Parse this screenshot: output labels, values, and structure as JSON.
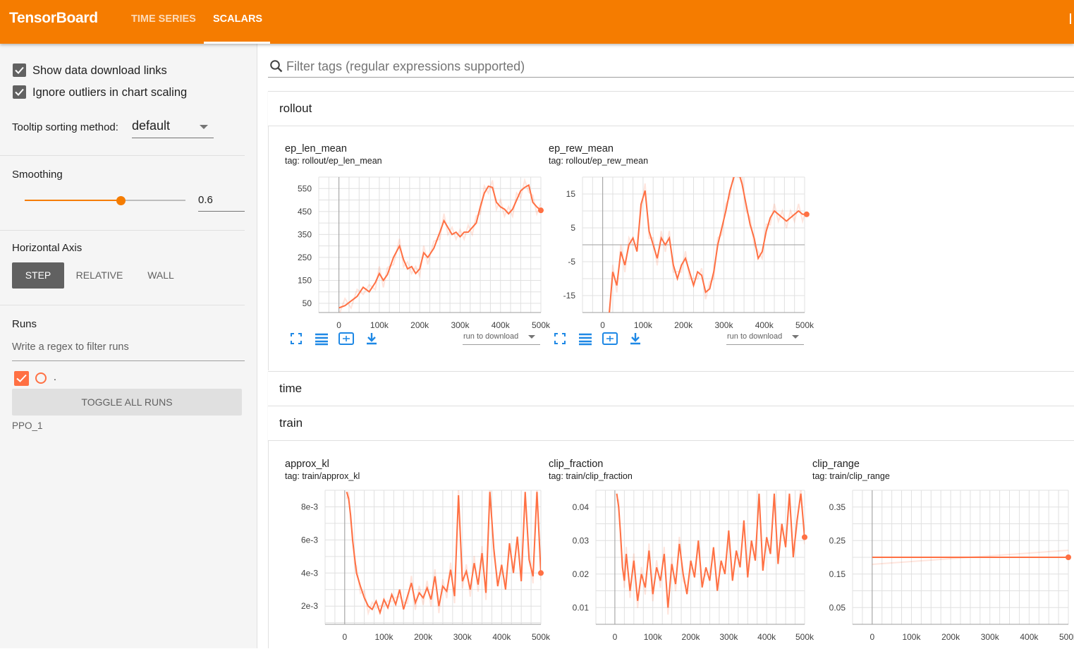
{
  "header": {
    "brand": "TensorBoard",
    "tabs": [
      {
        "label": "TIME SERIES",
        "active": false
      },
      {
        "label": "SCALARS",
        "active": true
      }
    ],
    "color": "#f57c00"
  },
  "sidebar": {
    "show_download_links": {
      "label": "Show data download links",
      "checked": true
    },
    "ignore_outliers": {
      "label": "Ignore outliers in chart scaling",
      "checked": true
    },
    "tooltip_sorting": {
      "label": "Tooltip sorting method:",
      "value": "default"
    },
    "smoothing": {
      "label": "Smoothing",
      "value": "0.6",
      "fraction": 0.6
    },
    "horizontal_axis": {
      "label": "Horizontal Axis",
      "options": [
        "STEP",
        "RELATIVE",
        "WALL"
      ],
      "selected": "STEP"
    },
    "runs": {
      "label": "Runs",
      "filter_placeholder": "Write a regex to filter runs",
      "items": [
        {
          "name": ".",
          "checked": true,
          "color": "#ff7043"
        }
      ],
      "toggle_label": "TOGGLE ALL RUNS",
      "group": "PPO_1"
    }
  },
  "main": {
    "search_placeholder": "Filter tags (regular expressions supported)",
    "download_select": "run to download",
    "sections": [
      {
        "title": "rollout"
      },
      {
        "title": "time"
      },
      {
        "title": "train"
      }
    ]
  },
  "chart_data": [
    {
      "type": "line",
      "title": "ep_len_mean",
      "tag": "tag: rollout/ep_len_mean",
      "xlim": [
        -50,
        500
      ],
      "ylim": [
        10,
        600
      ],
      "xticks": [
        0,
        100,
        200,
        300,
        400,
        500
      ],
      "xtick_labels": [
        "0",
        "100k",
        "200k",
        "300k",
        "400k",
        "500k"
      ],
      "yticks": [
        50,
        150,
        250,
        350,
        450,
        550
      ],
      "ytick_labels": [
        "50",
        "150",
        "250",
        "350",
        "450",
        "550"
      ],
      "color": "#ff7043",
      "series": [
        {
          "x": [
            0,
            15,
            30,
            45,
            60,
            75,
            90,
            100,
            110,
            120,
            135,
            150,
            160,
            170,
            180,
            190,
            200,
            210,
            220,
            235,
            250,
            260,
            270,
            280,
            290,
            300,
            310,
            320,
            330,
            340,
            350,
            360,
            370,
            380,
            390,
            400,
            410,
            420,
            430,
            440,
            450,
            460,
            470,
            480,
            490,
            500
          ],
          "values": [
            30,
            40,
            60,
            80,
            120,
            100,
            140,
            180,
            150,
            175,
            250,
            300,
            240,
            200,
            210,
            180,
            200,
            270,
            250,
            290,
            360,
            410,
            380,
            350,
            360,
            340,
            360,
            360,
            380,
            400,
            470,
            530,
            560,
            555,
            490,
            470,
            460,
            440,
            460,
            500,
            540,
            555,
            565,
            490,
            470,
            455
          ]
        }
      ]
    },
    {
      "type": "line",
      "title": "ep_rew_mean",
      "tag": "tag: rollout/ep_rew_mean",
      "xlim": [
        -50,
        500
      ],
      "ylim": [
        -20,
        20
      ],
      "xticks": [
        0,
        100,
        200,
        300,
        400,
        500
      ],
      "xtick_labels": [
        "0",
        "100k",
        "200k",
        "300k",
        "400k",
        "500k"
      ],
      "yticks": [
        -15,
        -5,
        5,
        15
      ],
      "ytick_labels": [
        "-15",
        "-5",
        "5",
        "15"
      ],
      "color": "#ff7043",
      "series": [
        {
          "x": [
            15,
            25,
            35,
            45,
            55,
            65,
            75,
            85,
            95,
            105,
            115,
            125,
            135,
            145,
            155,
            165,
            175,
            185,
            195,
            205,
            215,
            225,
            235,
            245,
            255,
            265,
            275,
            285,
            295,
            305,
            315,
            325,
            335,
            345,
            355,
            365,
            375,
            385,
            395,
            405,
            415,
            425,
            435,
            445,
            455,
            465,
            475,
            485,
            495,
            505
          ],
          "values": [
            -22,
            -8,
            -12,
            -2,
            -6,
            0,
            2,
            -2,
            12,
            16,
            4,
            0,
            -4,
            2,
            0,
            2,
            -6,
            -10,
            -6,
            -4,
            -8,
            -12,
            -8,
            -9,
            -14,
            -13,
            -8,
            0,
            5,
            10,
            16,
            20,
            22,
            18,
            12,
            6,
            2,
            -4,
            -2,
            4,
            8,
            10,
            9,
            8,
            7,
            8,
            9,
            10,
            9,
            9
          ]
        }
      ]
    },
    {
      "type": "line",
      "title": "approx_kl",
      "tag": "tag: train/approx_kl",
      "xlim": [
        -50,
        500
      ],
      "ylim": [
        0.0009,
        0.009
      ],
      "xticks": [
        0,
        100,
        200,
        300,
        400,
        500
      ],
      "xtick_labels": [
        "0",
        "100k",
        "200k",
        "300k",
        "400k",
        "500k"
      ],
      "yticks": [
        0.002,
        0.004,
        0.006,
        0.008
      ],
      "ytick_labels": [
        "2e-3",
        "4e-3",
        "6e-3",
        "8e-3"
      ],
      "color": "#ff7043",
      "series": [
        {
          "x": [
            5,
            10,
            15,
            20,
            25,
            30,
            40,
            50,
            60,
            70,
            80,
            90,
            100,
            110,
            120,
            130,
            140,
            150,
            160,
            170,
            180,
            190,
            200,
            210,
            220,
            230,
            240,
            250,
            260,
            270,
            280,
            290,
            300,
            310,
            320,
            330,
            340,
            350,
            360,
            370,
            380,
            390,
            400,
            410,
            420,
            430,
            440,
            450,
            460,
            470,
            480,
            490,
            500
          ],
          "values": [
            0.0089,
            0.0085,
            0.0075,
            0.006,
            0.005,
            0.004,
            0.0032,
            0.0025,
            0.002,
            0.0018,
            0.0023,
            0.0016,
            0.0024,
            0.0019,
            0.0027,
            0.0021,
            0.003,
            0.0018,
            0.0026,
            0.0034,
            0.0022,
            0.0028,
            0.0025,
            0.0031,
            0.0024,
            0.0038,
            0.002,
            0.0032,
            0.0029,
            0.0042,
            0.0026,
            0.0087,
            0.0035,
            0.0041,
            0.003,
            0.0046,
            0.0033,
            0.0052,
            0.0028,
            0.0089,
            0.0055,
            0.0032,
            0.0045,
            0.003,
            0.0058,
            0.004,
            0.0062,
            0.0035,
            0.0089,
            0.0048,
            0.0038,
            0.0089,
            0.004
          ]
        }
      ]
    },
    {
      "type": "line",
      "title": "clip_fraction",
      "tag": "tag: train/clip_fraction",
      "xlim": [
        -50,
        500
      ],
      "ylim": [
        0.005,
        0.045
      ],
      "xticks": [
        0,
        100,
        200,
        300,
        400,
        500
      ],
      "xtick_labels": [
        "0",
        "100k",
        "200k",
        "300k",
        "400k",
        "500k"
      ],
      "yticks": [
        0.01,
        0.02,
        0.03,
        0.04
      ],
      "ytick_labels": [
        "0.01",
        "0.02",
        "0.03",
        "0.04"
      ],
      "color": "#ff7043",
      "series": [
        {
          "x": [
            5,
            10,
            15,
            20,
            25,
            30,
            40,
            50,
            60,
            70,
            80,
            90,
            100,
            110,
            120,
            130,
            140,
            150,
            160,
            170,
            180,
            190,
            200,
            210,
            220,
            230,
            240,
            250,
            260,
            270,
            280,
            290,
            300,
            310,
            320,
            330,
            340,
            350,
            360,
            370,
            380,
            390,
            400,
            410,
            420,
            430,
            440,
            450,
            460,
            470,
            480,
            490,
            500
          ],
          "values": [
            0.044,
            0.04,
            0.032,
            0.022,
            0.018,
            0.026,
            0.015,
            0.024,
            0.012,
            0.02,
            0.016,
            0.027,
            0.014,
            0.022,
            0.018,
            0.026,
            0.01,
            0.023,
            0.017,
            0.029,
            0.02,
            0.014,
            0.024,
            0.019,
            0.03,
            0.016,
            0.022,
            0.018,
            0.028,
            0.015,
            0.024,
            0.02,
            0.033,
            0.018,
            0.027,
            0.022,
            0.036,
            0.019,
            0.03,
            0.024,
            0.044,
            0.021,
            0.031,
            0.026,
            0.044,
            0.023,
            0.035,
            0.028,
            0.044,
            0.025,
            0.036,
            0.044,
            0.031
          ]
        }
      ]
    },
    {
      "type": "line",
      "title": "clip_range",
      "tag": "tag: train/clip_range",
      "xlim": [
        -50,
        500
      ],
      "ylim": [
        0,
        0.4
      ],
      "xticks": [
        0,
        100,
        200,
        300,
        400,
        500
      ],
      "xtick_labels": [
        "0",
        "100k",
        "200k",
        "300k",
        "400k",
        "500k"
      ],
      "yticks": [
        0.05,
        0.15,
        0.25,
        0.35
      ],
      "ytick_labels": [
        "0.05",
        "0.15",
        "0.25",
        "0.35"
      ],
      "color": "#ff7043",
      "series": [
        {
          "x": [
            0,
            500
          ],
          "values": [
            0.2,
            0.2
          ]
        }
      ]
    }
  ]
}
